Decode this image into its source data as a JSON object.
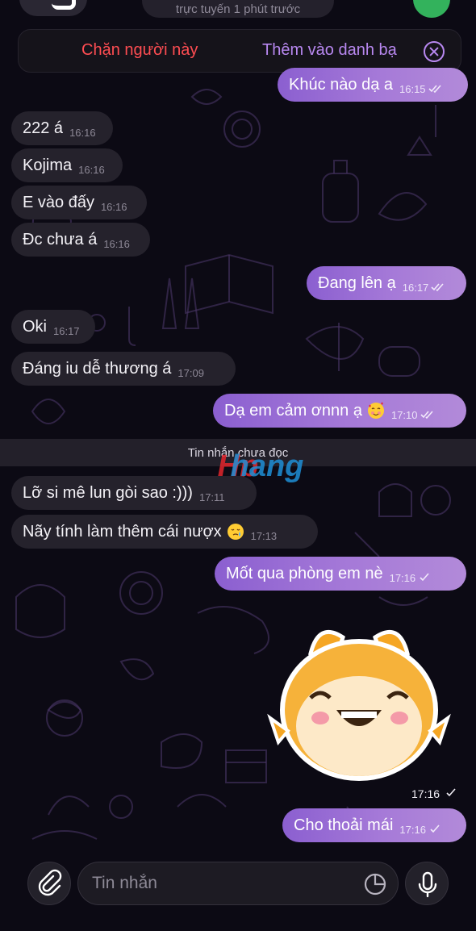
{
  "header": {
    "status_text": "trực tuyến 1 phút trước"
  },
  "action_bar": {
    "block_label": "Chặn người này",
    "add_contact_label": "Thêm vào danh bạ"
  },
  "messages": [
    {
      "text": "Khúc nào dạ a",
      "time": "16:15",
      "read": true
    },
    {
      "text": "222 á",
      "time": "16:16"
    },
    {
      "text": "Kojima",
      "time": "16:16"
    },
    {
      "text": "E vào đấy",
      "time": "16:16"
    },
    {
      "text": "Đc chưa á",
      "time": "16:16"
    },
    {
      "text": "Đang lên ạ",
      "time": "16:17",
      "read": true
    },
    {
      "text": "Oki",
      "time": "16:17"
    },
    {
      "text": "Đáng iu dễ thương á",
      "time": "17:09"
    },
    {
      "text": "Dạ em cảm ơnnn ạ",
      "time": "17:10",
      "read": true,
      "emoji": "smiling-face-with-hearts-icon"
    },
    {
      "text": "Lỡ si mê lun gòi sao :)))",
      "time": "17:11"
    },
    {
      "text": "Nãy tính làm thêm cái nượx",
      "time": "17:13",
      "emoji": "crying-face-icon"
    },
    {
      "text": "Mốt qua phòng em nè",
      "time": "17:16",
      "read": false
    },
    {
      "text": "Cho thoải mái",
      "time": "17:16",
      "read": false
    }
  ],
  "unread_divider": "Tin nhắn chưa đọc",
  "watermark": "Hphang",
  "sticker": {
    "icon": "fox-sticker",
    "time": "17:16",
    "read": false
  },
  "composer": {
    "placeholder": "Tin nhắn"
  },
  "colors": {
    "outgoing_bubble": "#a67ad8",
    "incoming_bubble": "#25222c",
    "background": "#0c0a14",
    "danger": "#ff4d52",
    "accent": "#b888f0"
  }
}
